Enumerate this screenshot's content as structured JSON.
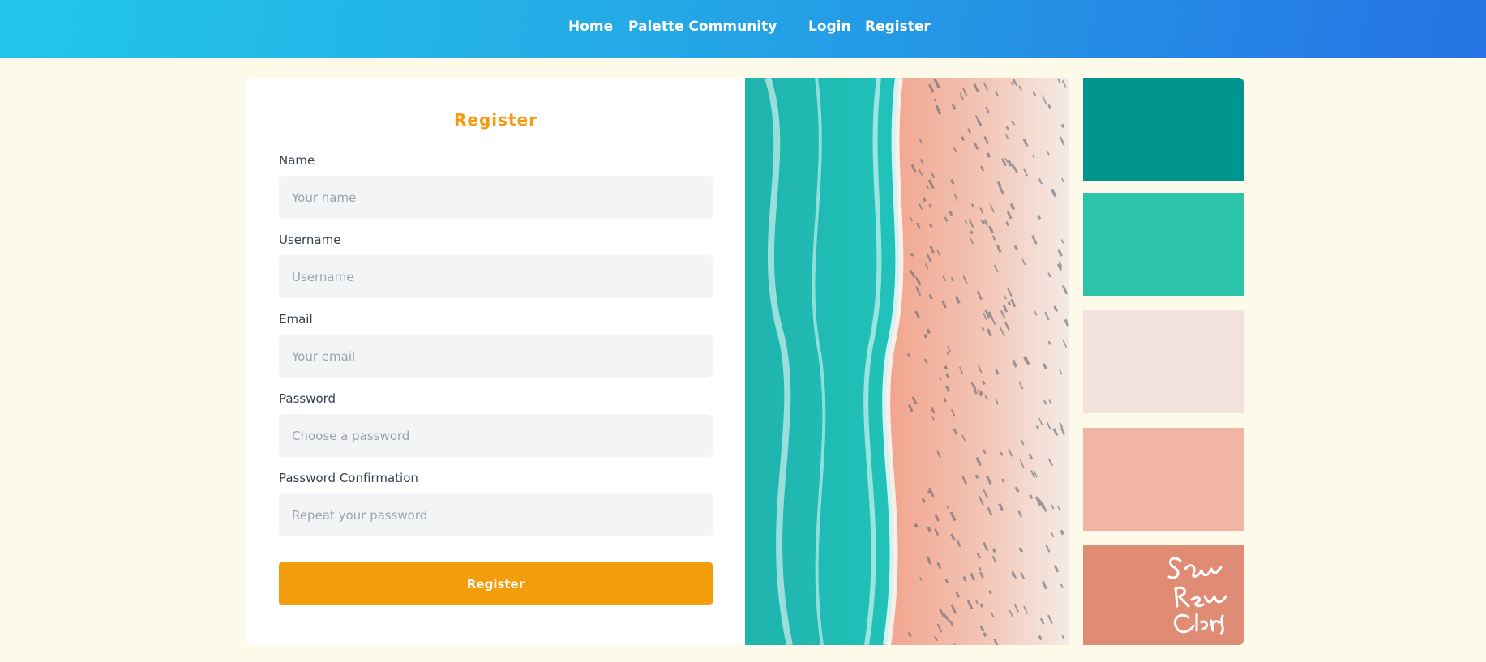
{
  "nav": {
    "links": [
      "Home",
      "Palette Community",
      "Login",
      "Register"
    ]
  },
  "form": {
    "title": "Register",
    "fields": [
      {
        "label": "Name",
        "placeholder": "Your name",
        "value": ""
      },
      {
        "label": "Username",
        "placeholder": "Username",
        "value": ""
      },
      {
        "label": "Email",
        "placeholder": "Your email",
        "value": ""
      },
      {
        "label": "Password",
        "placeholder": "Choose a password",
        "value": ""
      },
      {
        "label": "Password Confirmation",
        "placeholder": "Repeat your password",
        "value": ""
      }
    ],
    "submit_label": "Register"
  },
  "palette": {
    "image": "aerial-beach-photo",
    "colors": [
      "#00968f",
      "#2dc4ac",
      "#f1e2de",
      "#f2b5a3",
      "#e08b74"
    ],
    "signature": "Sarah Renae Clark"
  },
  "colors": {
    "accent": "#f39c12",
    "header_start": "#22c7ea",
    "header_end": "#2573e4",
    "background": "#fefae9"
  }
}
